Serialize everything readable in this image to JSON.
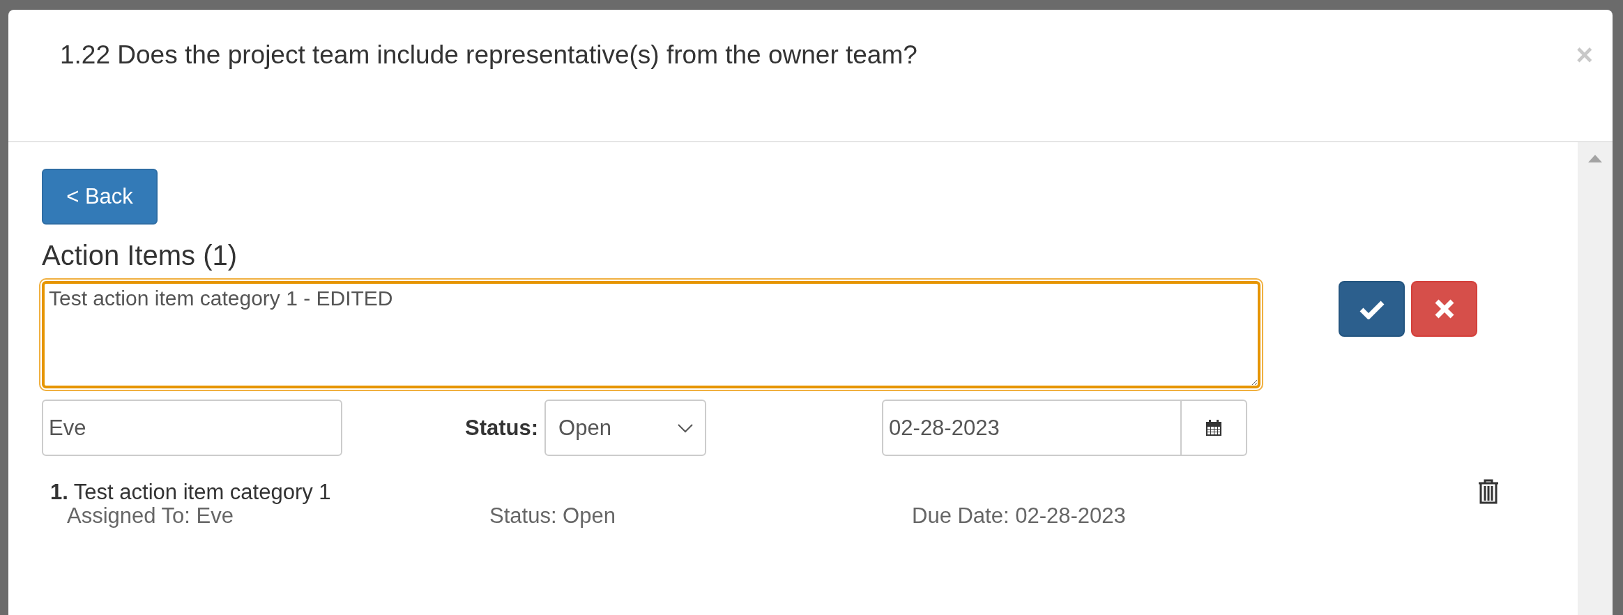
{
  "dialog": {
    "title": "1.22 Does the project team include representative(s) from the owner team?",
    "close": "×"
  },
  "back_button": "< Back",
  "section_title": "Action Items (1)",
  "editor": {
    "description": "Test action item category 1 - EDITED",
    "focused": true,
    "assignee": "Eve",
    "status_label": "Status:",
    "status": "Open",
    "due_date": "02-28-2023"
  },
  "items": [
    {
      "number": "1.",
      "title": "Test action item category 1",
      "assigned": "Assigned To: Eve",
      "status": "Status: Open",
      "due": "Due Date: 02-28-2023"
    }
  ]
}
